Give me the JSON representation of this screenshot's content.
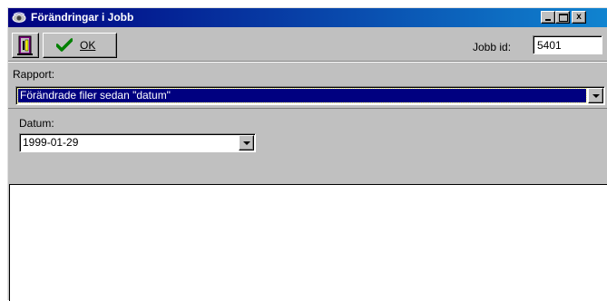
{
  "window": {
    "title": "Förändringar i Jobb",
    "close_label": "x"
  },
  "toolbar": {
    "ok_label": "OK",
    "job_id_label": "Jobb id:",
    "job_id_value": "5401"
  },
  "rapport": {
    "label": "Rapport:",
    "selected": "Förändrade filer sedan \"datum\""
  },
  "datum": {
    "label": "Datum:",
    "selected": "1999-01-29"
  },
  "colors": {
    "titlebar": "#000080",
    "face": "#c0c0c0",
    "selection": "#000080"
  }
}
